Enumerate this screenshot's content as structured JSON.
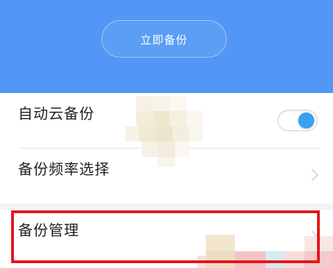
{
  "header": {
    "backup_now_label": "立即备份",
    "background_color": "#5297f5"
  },
  "settings": {
    "auto_cloud_backup": {
      "label": "自动云备份",
      "toggle_on": true,
      "toggle_color": "#3aa0f0"
    },
    "backup_frequency": {
      "label": "备份频率选择",
      "icon": "chevron-right-icon"
    },
    "backup_management": {
      "label": "备份管理",
      "icon": "chevron-right-icon"
    }
  },
  "annotation": {
    "highlight_color": "#e5141b"
  }
}
